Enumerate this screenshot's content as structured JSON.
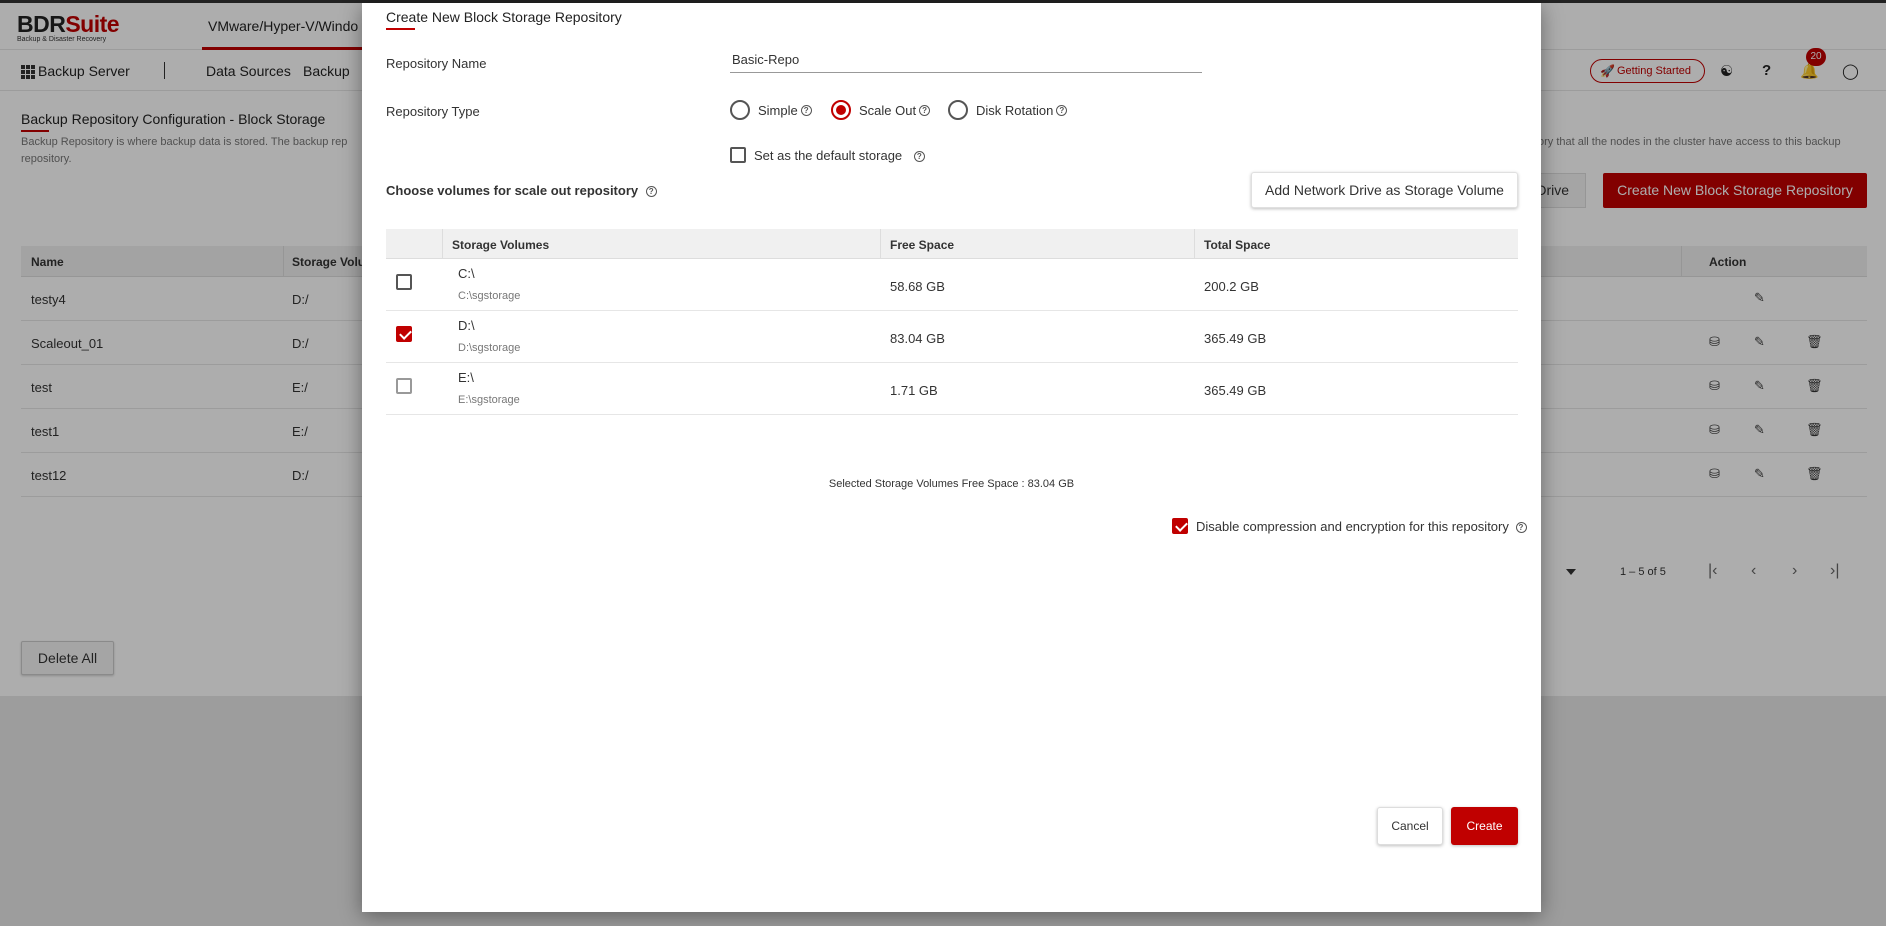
{
  "brand": {
    "name_bdr": "BDR",
    "name_suite": "Suite",
    "tagline": "Backup & Disaster Recovery",
    "accent_color": "#c00000"
  },
  "product_tab": "VMware/Hyper-V/Windo",
  "nav": {
    "server": "Backup Server",
    "items": [
      "Data Sources",
      "Backup"
    ],
    "getting_started": "Getting Started",
    "notification_count": "20",
    "icons": [
      "rocket-icon",
      "users-icon",
      "help-icon",
      "bell-icon",
      "account-icon"
    ]
  },
  "page": {
    "title": "Backup Repository Configuration - Block Storage",
    "desc_left": "Backup Repository is where backup data is stored. The backup rep",
    "desc_left_2": "repository.",
    "desc_right": "ory that all the nodes in the cluster have access to this backup",
    "btn_drive": "Drive",
    "btn_create": "Create New Block Storage Repository",
    "table": {
      "headers": [
        "Name",
        "Storage Volu",
        "Action"
      ],
      "rows": [
        {
          "name": "testy4",
          "volume": "D:/"
        },
        {
          "name": "Scaleout_01",
          "volume": "D:/"
        },
        {
          "name": "test",
          "volume": "E:/"
        },
        {
          "name": "test1",
          "volume": "E:/"
        },
        {
          "name": "test12",
          "volume": "D:/"
        }
      ]
    },
    "pager_range": "1 – 5 of 5",
    "delete_all": "Delete All"
  },
  "modal": {
    "title": "Create New Block Storage Repository",
    "repo_name_label": "Repository Name",
    "repo_name_value": "Basic-Repo",
    "repo_type_label": "Repository Type",
    "repo_types": [
      {
        "label": "Simple",
        "selected": false
      },
      {
        "label": "Scale Out",
        "selected": true
      },
      {
        "label": "Disk Rotation",
        "selected": false
      }
    ],
    "default_storage_label": "Set as the default storage",
    "default_storage_checked": false,
    "choose_label": "Choose volumes for scale out repository",
    "add_network_btn": "Add Network Drive as Storage Volume",
    "volumes_table": {
      "headers": [
        "Storage Volumes",
        "Free Space",
        "Total Space"
      ],
      "rows": [
        {
          "drive": "C:\\",
          "path": "C:\\sgstorage",
          "free": "58.68 GB",
          "total": "200.2 GB",
          "checked": false
        },
        {
          "drive": "D:\\",
          "path": "D:\\sgstorage",
          "free": "83.04 GB",
          "total": "365.49 GB",
          "checked": true
        },
        {
          "drive": "E:\\",
          "path": "E:\\sgstorage",
          "free": "1.71 GB",
          "total": "365.49 GB",
          "checked": false
        }
      ]
    },
    "selected_free": "Selected Storage Volumes Free Space : 83.04 GB",
    "disable_compression_label": "Disable compression and encryption for this repository",
    "disable_compression_checked": true,
    "cancel": "Cancel",
    "create": "Create"
  }
}
